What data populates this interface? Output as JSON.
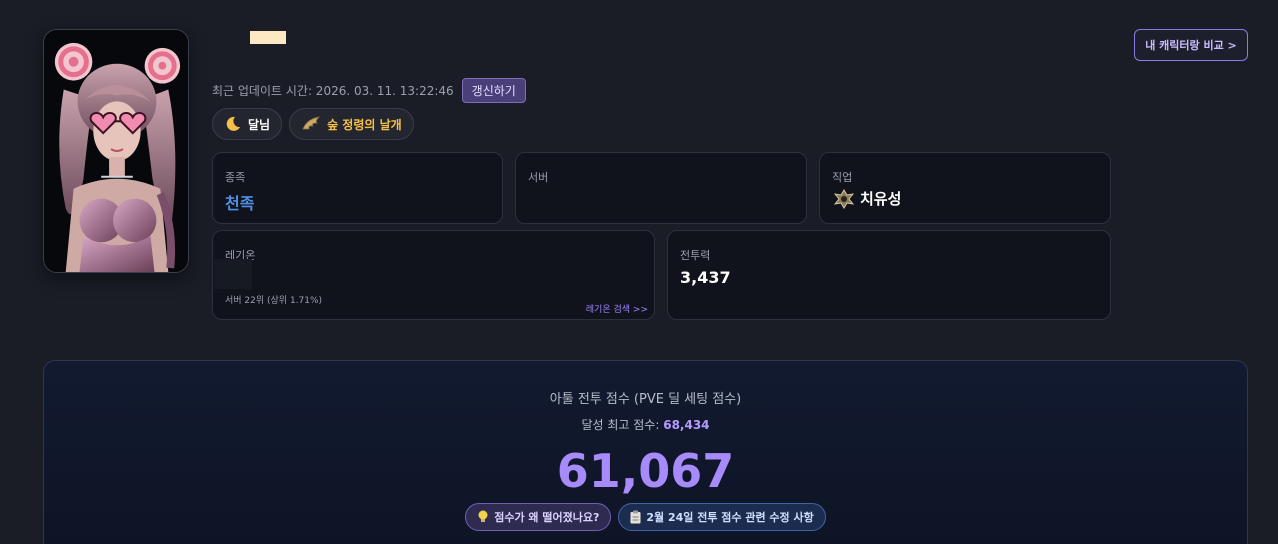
{
  "header": {
    "update_label": "최근 업데이트 시간: 2026. 03. 11. 13:22:46",
    "refresh_label": "갱신하기",
    "compare_label": "내 캐릭터랑 비교 >"
  },
  "tags": [
    {
      "icon": "moon-icon",
      "label": "달님"
    },
    {
      "icon": "wing-icon",
      "label": "숲 정령의 날개"
    }
  ],
  "info": {
    "race": {
      "label": "종족",
      "value": "천족"
    },
    "server": {
      "label": "서버",
      "value": ""
    },
    "job": {
      "label": "직업",
      "value": "치유성",
      "icon": "cleric-emblem-icon"
    },
    "legion": {
      "label": "레기온",
      "rank": "서버 22위 (상위 1.71%)",
      "link": "레기온 검색 >>"
    },
    "power": {
      "label": "전투력",
      "value": "3,437"
    }
  },
  "score": {
    "title": "아툴 전투 점수 (PVE 딜 세팅 점수)",
    "best_label": "달성 최고 점수:",
    "best_value": "68,434",
    "current": "61,067",
    "btn_why": "점수가 왜 떨어졌나요?",
    "btn_notice": "2월 24일 전투 점수 관련 수정 사항"
  },
  "colors": {
    "accent": "#a78bfa",
    "race": "#4f8fe8",
    "background": "#1a1d26"
  }
}
